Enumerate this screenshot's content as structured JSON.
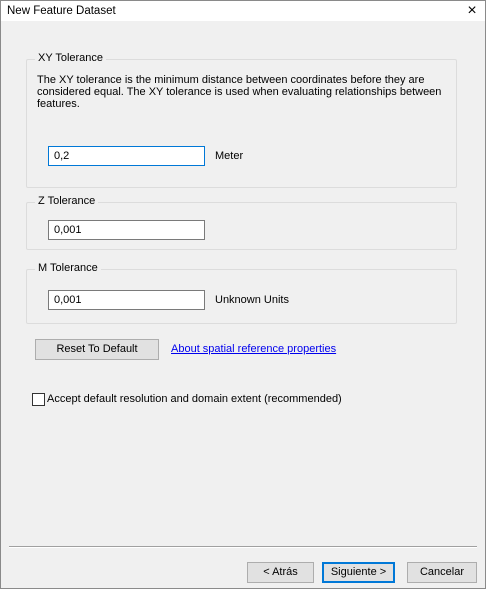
{
  "window": {
    "title": "New Feature Dataset",
    "close_icon": "×"
  },
  "xy_group": {
    "legend": "XY Tolerance",
    "description": "The XY tolerance is the minimum distance between coordinates before they are considered equal. The XY tolerance is used when evaluating relationships between features.",
    "value": "0,2",
    "unit": "Meter"
  },
  "z_group": {
    "legend": "Z Tolerance",
    "value": "0,001"
  },
  "m_group": {
    "legend": "M Tolerance",
    "value": "0,001",
    "unit": "Unknown Units"
  },
  "reset_button": "Reset To Default",
  "about_link": "About spatial reference properties",
  "accept_checkbox": {
    "label": "Accept default resolution and domain extent (recommended)",
    "checked": false
  },
  "footer": {
    "back": "< Atrás",
    "next": "Siguiente >",
    "cancel": "Cancelar"
  },
  "colors": {
    "focus_border": "#0078d7",
    "link": "#0000ee",
    "background": "#f0f0f0"
  }
}
